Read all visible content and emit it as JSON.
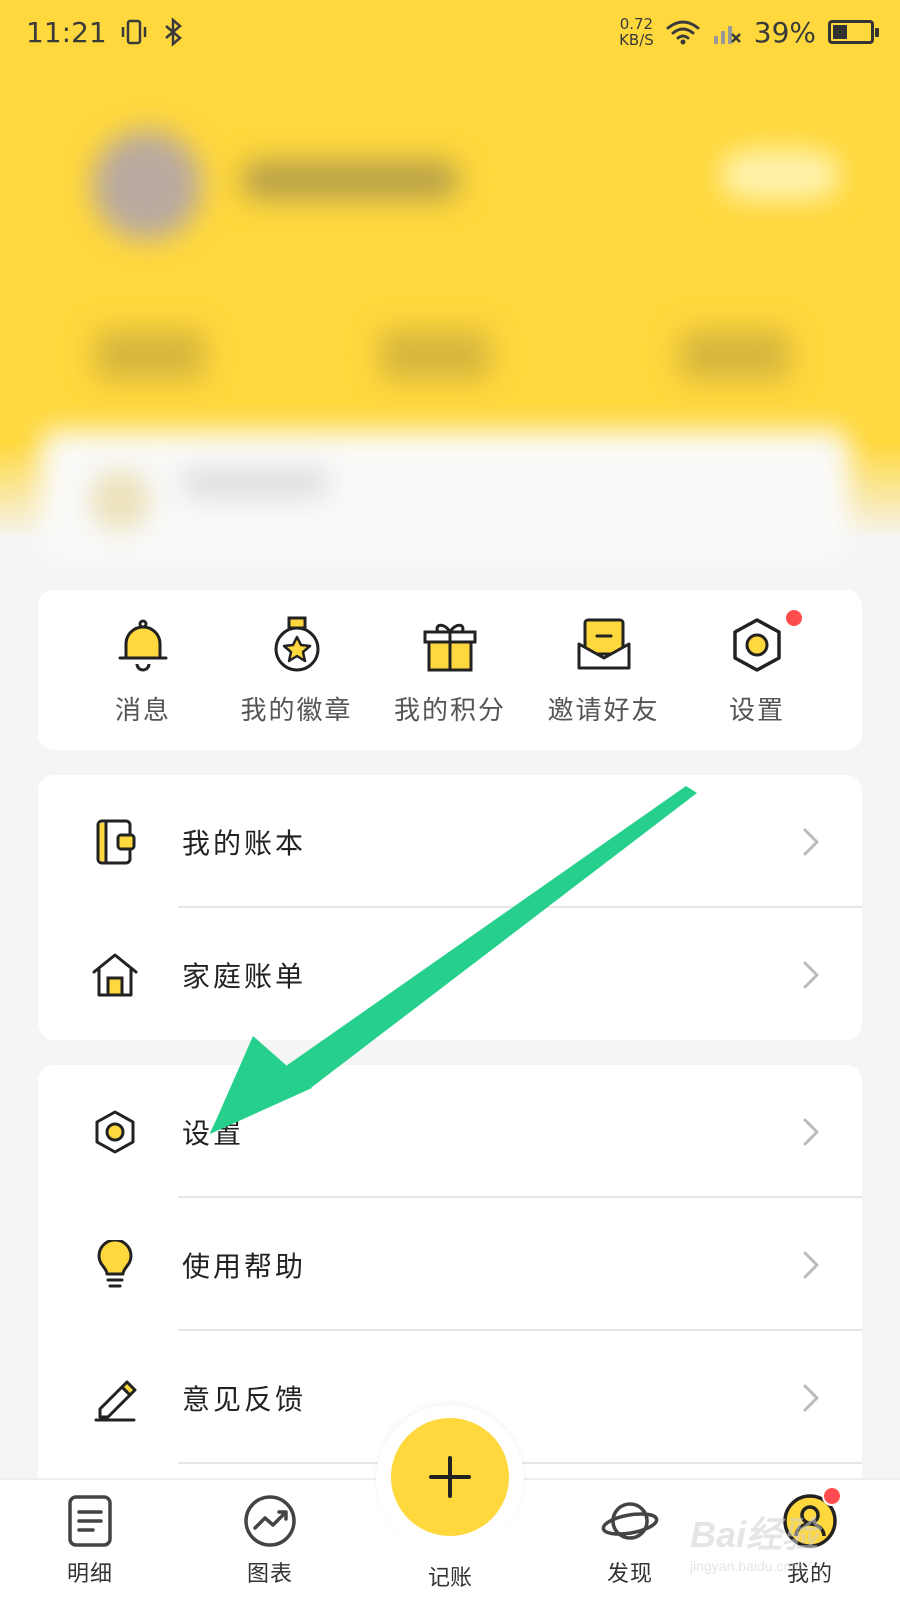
{
  "status_bar": {
    "time": "11:21",
    "net_speed_value": "0.72",
    "net_speed_unit": "KB/S",
    "battery_percent": "39%",
    "battery_level": 0.39
  },
  "quick_actions": [
    {
      "label": "消息",
      "icon": "bell-icon"
    },
    {
      "label": "我的徽章",
      "icon": "badge-medal-icon"
    },
    {
      "label": "我的积分",
      "icon": "gift-icon"
    },
    {
      "label": "邀请好友",
      "icon": "invite-envelope-icon"
    },
    {
      "label": "设置",
      "icon": "settings-hex-icon",
      "has_notification_dot": true
    }
  ],
  "menu_group_1": [
    {
      "label": "我的账本",
      "icon": "ledger-book-icon"
    },
    {
      "label": "家庭账单",
      "icon": "house-icon"
    }
  ],
  "menu_group_2": [
    {
      "label": "设置",
      "icon": "settings-hex-icon"
    },
    {
      "label": "使用帮助",
      "icon": "lightbulb-icon"
    },
    {
      "label": "意见反馈",
      "icon": "pencil-icon"
    }
  ],
  "bottom_nav": [
    {
      "label": "明细",
      "icon": "list-doc-icon"
    },
    {
      "label": "图表",
      "icon": "chart-trend-icon"
    },
    {
      "label": "记账",
      "icon": "plus-icon"
    },
    {
      "label": "发现",
      "icon": "planet-icon"
    },
    {
      "label": "我的",
      "icon": "profile-icon",
      "active": true
    }
  ],
  "watermark": {
    "main": "Bai经验",
    "sub": "jingyan.baidu.com"
  },
  "colors": {
    "accent": "#ffd83d",
    "annotation_arrow": "#26d08c",
    "notification": "#ff4d4f"
  }
}
